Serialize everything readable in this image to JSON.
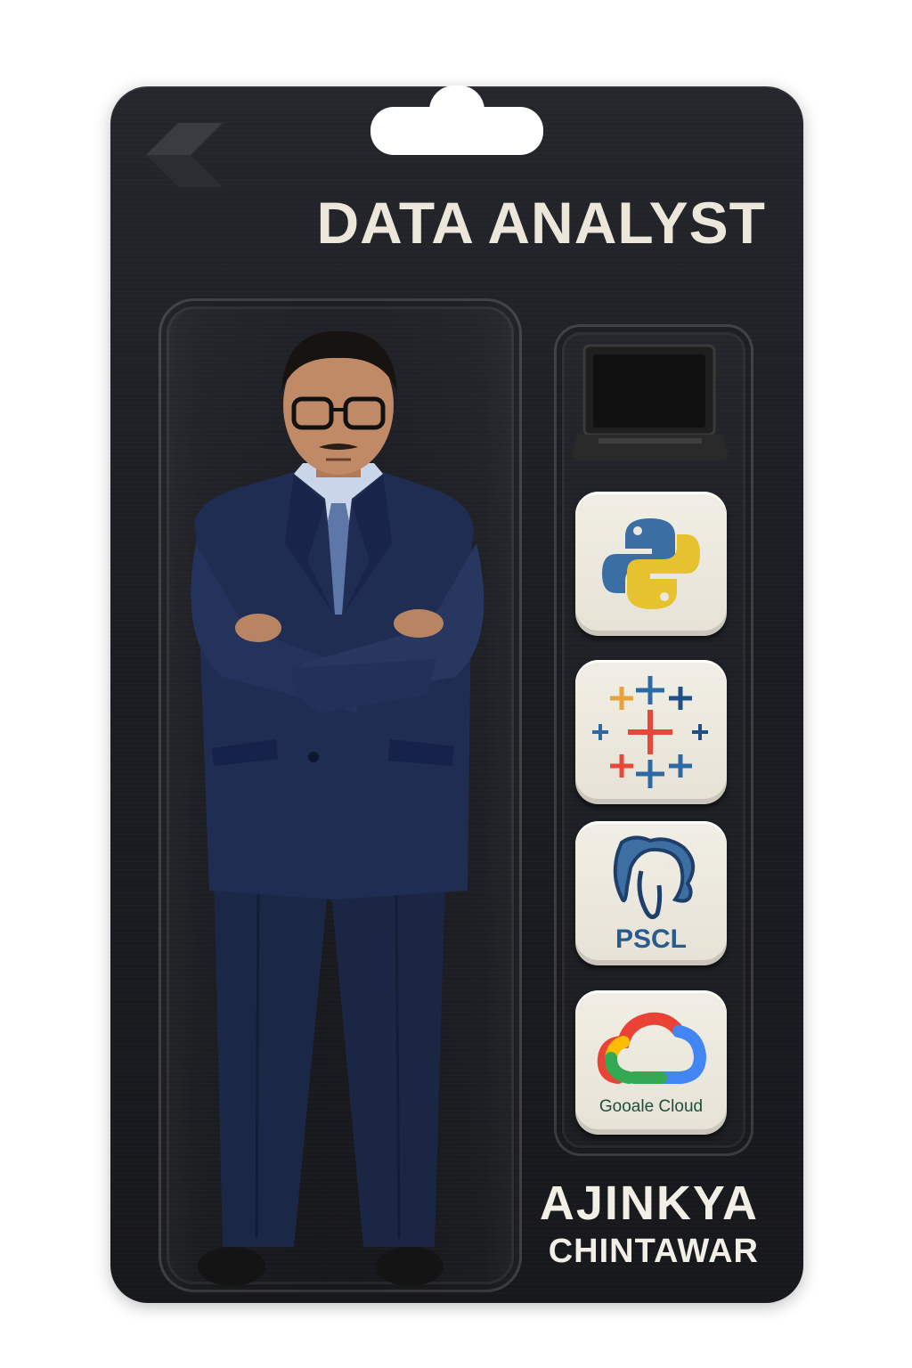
{
  "package": {
    "title": "DATA ANALYST",
    "brand_icon": "chevron-left-logo-icon"
  },
  "figure": {
    "icon": "businessman-figure",
    "colors": {
      "suit": "#1d2a4c",
      "shirt": "#c9d6ea",
      "tie": "#5d77a8"
    }
  },
  "accessories": {
    "laptop_icon": "laptop-icon",
    "tiles": [
      {
        "icon": "python-logo-icon",
        "label": ""
      },
      {
        "icon": "tableau-logo-icon",
        "label": ""
      },
      {
        "icon": "postgresql-elephant-icon",
        "label": "PSCL"
      },
      {
        "icon": "google-cloud-logo-icon",
        "label": "Gooale Cloud"
      }
    ]
  },
  "name": {
    "first": "AJINKYA",
    "last": "CHINTAWAR"
  },
  "colors": {
    "card": "#1d1f24",
    "title_text": "#ece7da",
    "tile": "#ece8dd",
    "python_blue": "#3b6fa3",
    "python_yellow": "#e7c22f",
    "google_red": "#ea4335",
    "google_blue": "#4285f4",
    "google_green": "#34a853",
    "google_yellow": "#fbbc05"
  }
}
